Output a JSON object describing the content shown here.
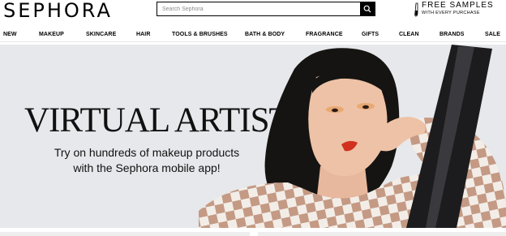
{
  "header": {
    "logo": "SEPHORA",
    "search": {
      "placeholder": "Search Sephora",
      "value": "",
      "button_icon": "search-icon"
    },
    "promo": {
      "title": "FREE SAMPLES",
      "subtitle": "WITH EVERY PURCHASE",
      "icon": "sample-vial-icon"
    }
  },
  "nav": {
    "items": [
      {
        "label": "NEW"
      },
      {
        "label": "MAKEUP"
      },
      {
        "label": "SKINCARE"
      },
      {
        "label": "HAIR"
      },
      {
        "label": "TOOLS & BRUSHES"
      },
      {
        "label": "BATH & BODY"
      },
      {
        "label": "FRAGRANCE"
      },
      {
        "label": "GIFTS"
      },
      {
        "label": "CLEAN"
      },
      {
        "label": "BRANDS"
      },
      {
        "label": "SALE"
      }
    ]
  },
  "hero": {
    "title": "VIRTUAL ARTIST",
    "subtitle": "Try on hundreds of makeup products\nwith the Sephora mobile app!",
    "image": "model-portrait"
  },
  "colors": {
    "hero_bg": "#e6e8eb",
    "lip": "#d1311f",
    "checker": "#c49a84"
  }
}
